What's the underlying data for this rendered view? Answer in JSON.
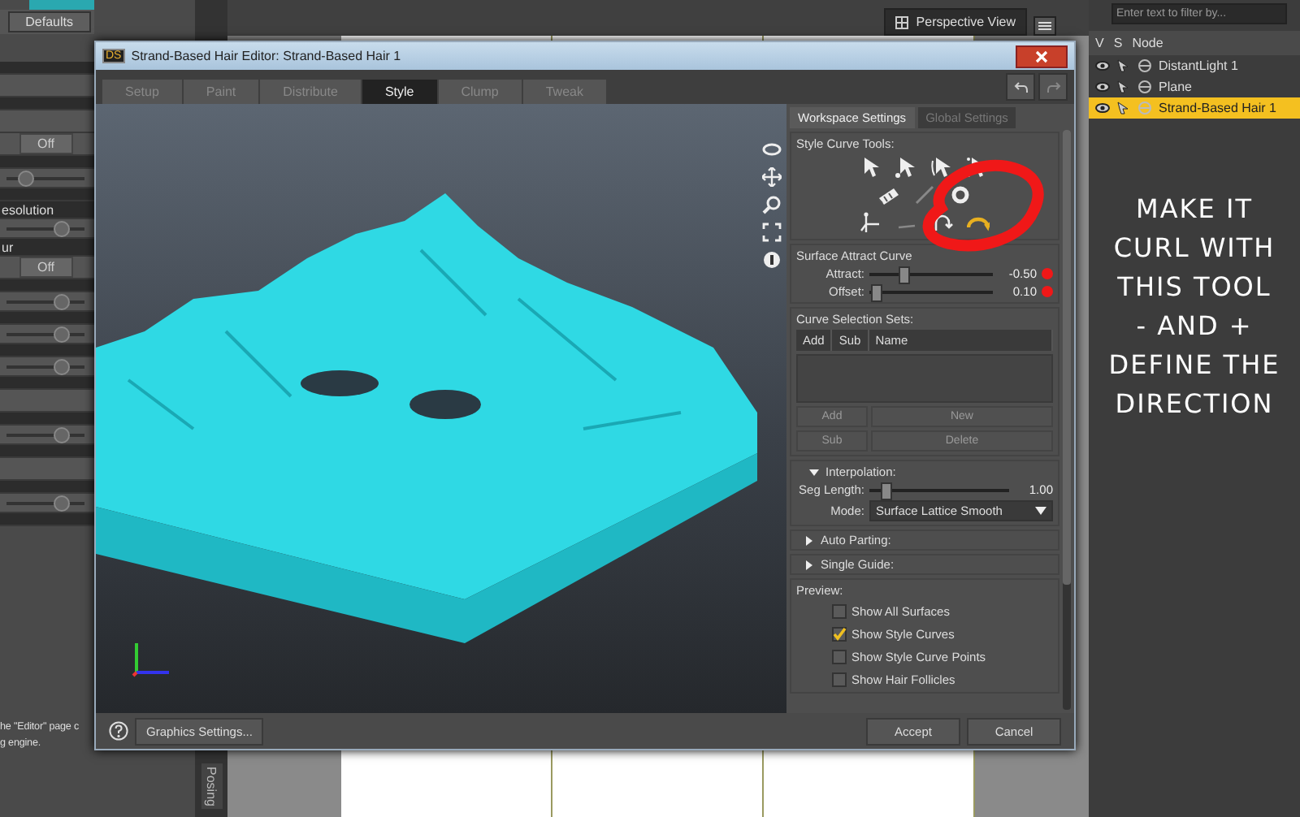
{
  "left_panel": {
    "defaults_button": "Defaults",
    "rows": [
      {
        "kind": "header"
      },
      {
        "kind": "plain"
      },
      {
        "kind": "header"
      },
      {
        "kind": "plain"
      },
      {
        "kind": "toggle",
        "value": "Off"
      },
      {
        "kind": "header"
      },
      {
        "kind": "slider",
        "level": 0.25
      },
      {
        "kind": "header"
      },
      {
        "kind": "label",
        "label": "esolution"
      },
      {
        "kind": "slider",
        "level": 0.7
      },
      {
        "kind": "label",
        "label": "ur"
      },
      {
        "kind": "toggle",
        "value": "Off"
      },
      {
        "kind": "header"
      },
      {
        "kind": "slider",
        "level": 0.7
      },
      {
        "kind": "header"
      },
      {
        "kind": "slider",
        "level": 0.7
      },
      {
        "kind": "header"
      },
      {
        "kind": "slider",
        "level": 0.7
      },
      {
        "kind": "header"
      },
      {
        "kind": "plain"
      },
      {
        "kind": "header"
      },
      {
        "kind": "slider",
        "level": 0.7
      },
      {
        "kind": "header"
      },
      {
        "kind": "plain"
      },
      {
        "kind": "header"
      },
      {
        "kind": "slider",
        "level": 0.7
      },
      {
        "kind": "header"
      }
    ],
    "help_text": "he \"Editor\" page c\ng engine."
  },
  "vertical_tab": "Posing",
  "viewport": {
    "view_menu": "Perspective View"
  },
  "outliner": {
    "filter_placeholder": "Enter text to filter by...",
    "columns": [
      "V",
      "S",
      "Node"
    ],
    "rows": [
      {
        "name": "DistantLight 1",
        "selected": false
      },
      {
        "name": "Plane",
        "selected": false
      },
      {
        "name": "Strand-Based Hair 1",
        "selected": true
      }
    ]
  },
  "annotation": "MAKE IT\nCURL WITH\nTHIS TOOL\n- AND +\nDEFINE THE\nDIRECTION",
  "dialog": {
    "badge": "DS",
    "title": "Strand-Based Hair Editor: Strand-Based Hair 1",
    "tabs": [
      {
        "label": "Setup",
        "selected": false
      },
      {
        "label": "Paint",
        "selected": false
      },
      {
        "label": "Distribute",
        "selected": false
      },
      {
        "label": "Style",
        "selected": true
      },
      {
        "label": "Clump",
        "selected": false
      },
      {
        "label": "Tweak",
        "selected": false
      }
    ],
    "panel_tabs": [
      {
        "label": "Workspace Settings",
        "selected": true
      },
      {
        "label": "Global Settings",
        "selected": false
      }
    ],
    "tools_label": "Style Curve Tools:",
    "attract": {
      "label": "Surface Attract Curve",
      "sliders": [
        {
          "label": "Attract:",
          "level": 0.28,
          "reading": "-0.50"
        },
        {
          "label": "Offset:",
          "level": 0.05,
          "reading": "0.10"
        }
      ]
    },
    "selection_sets": {
      "label": "Curve Selection Sets:",
      "columns": [
        "Add",
        "Sub",
        "Name"
      ],
      "buttons": [
        {
          "label": "Add",
          "disabled": true
        },
        {
          "label": "New",
          "disabled": true
        },
        {
          "label": "Sub",
          "disabled": true
        },
        {
          "label": "Delete",
          "disabled": true
        }
      ]
    },
    "interpolation": {
      "label": "Interpolation:",
      "expanded": true,
      "seg_length": {
        "label": "Seg Length:",
        "level": 0.12,
        "reading": "1.00"
      },
      "mode": {
        "label": "Mode:",
        "value": "Surface Lattice Smooth"
      }
    },
    "sections": [
      {
        "label": "Auto Parting:",
        "expanded": false
      },
      {
        "label": "Single Guide:",
        "expanded": false
      }
    ],
    "preview": {
      "label": "Preview:",
      "options": [
        {
          "label": "Show All Surfaces",
          "checked": false
        },
        {
          "label": "Show Style Curves",
          "checked": true
        },
        {
          "label": "Show Style Curve Points",
          "checked": false
        },
        {
          "label": "Show Hair Follicles",
          "checked": false
        }
      ]
    },
    "footer": {
      "graphics_button": "Graphics Settings...",
      "buttons": [
        "Accept",
        "Cancel"
      ]
    }
  }
}
